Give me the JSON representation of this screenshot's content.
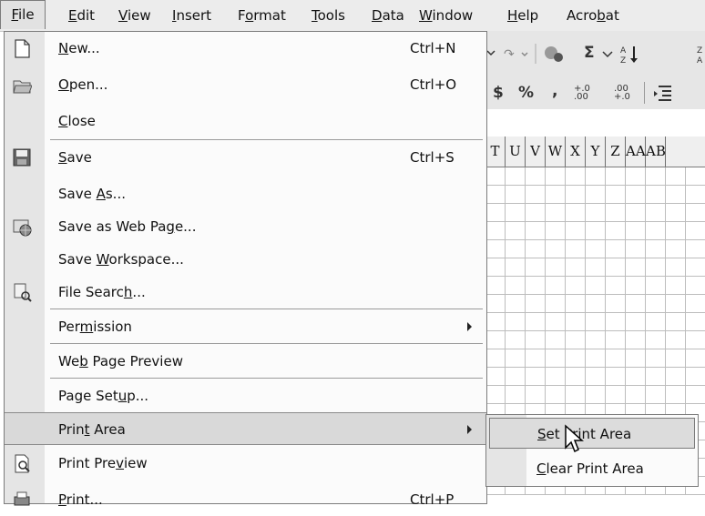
{
  "menubar": {
    "items": [
      {
        "label": "File",
        "key": "F",
        "rest": "ile"
      },
      {
        "label": "Edit",
        "key": "E",
        "rest": "dit"
      },
      {
        "label": "View",
        "key": "V",
        "rest": "iew"
      },
      {
        "label": "Insert",
        "key": "I",
        "rest": "nsert"
      },
      {
        "label": "Format",
        "pre": "F",
        "key": "o",
        "rest": "rmat"
      },
      {
        "label": "Tools",
        "key": "T",
        "rest": "ools"
      },
      {
        "label": "Data",
        "key": "D",
        "rest": "ata"
      },
      {
        "label": "Window",
        "key": "W",
        "rest": "indow"
      },
      {
        "label": "Help",
        "key": "H",
        "rest": "elp"
      },
      {
        "label": "Acrobat",
        "pre": "Acro",
        "key": "b",
        "rest": "at"
      }
    ]
  },
  "toolbar": {
    "sigma": "Σ",
    "dollar": "$",
    "percent": "%",
    "comma": ",",
    "inc_decimal": "+.0 .00",
    "dec_decimal": ".00 +.0"
  },
  "columns": [
    "T",
    "U",
    "V",
    "W",
    "X",
    "Y",
    "Z",
    "AA",
    "AB"
  ],
  "file_menu": {
    "items": [
      {
        "pre": "",
        "key": "N",
        "rest": "ew...",
        "shortcut": "Ctrl+N",
        "icon": "new-document-icon"
      },
      {
        "pre": "",
        "key": "O",
        "rest": "pen...",
        "shortcut": "Ctrl+O",
        "icon": "open-folder-icon"
      },
      {
        "pre": "",
        "key": "C",
        "rest": "lose",
        "shortcut": "",
        "icon": ""
      },
      {
        "pre": "",
        "key": "S",
        "rest": "ave",
        "shortcut": "Ctrl+S",
        "icon": "save-disk-icon"
      },
      {
        "pre": "Save ",
        "key": "A",
        "rest": "s...",
        "shortcut": "",
        "icon": ""
      },
      {
        "pre": "Save as Web Pa",
        "key": "g",
        "rest": "e...",
        "shortcut": "",
        "icon": "web-page-icon"
      },
      {
        "pre": "Save ",
        "key": "W",
        "rest": "orkspace...",
        "shortcut": "",
        "icon": ""
      },
      {
        "pre": "File Searc",
        "key": "h",
        "rest": "...",
        "shortcut": "",
        "icon": "file-search-icon"
      },
      {
        "pre": "Per",
        "key": "m",
        "rest": "ission",
        "shortcut": "",
        "icon": "",
        "submenu": true
      },
      {
        "pre": "We",
        "key": "b",
        "rest": " Page Preview",
        "shortcut": "",
        "icon": ""
      },
      {
        "pre": "Page Set",
        "key": "u",
        "rest": "p...",
        "shortcut": "",
        "icon": ""
      },
      {
        "pre": "Prin",
        "key": "t",
        "rest": " Area",
        "shortcut": "",
        "icon": "",
        "submenu": true,
        "highlighted": true
      },
      {
        "pre": "Print Pre",
        "key": "v",
        "rest": "iew",
        "shortcut": "",
        "icon": "print-preview-icon"
      },
      {
        "pre": "",
        "key": "P",
        "rest": "rint...",
        "shortcut": "Ctrl+P",
        "icon": "print-icon"
      }
    ]
  },
  "print_area_submenu": {
    "items": [
      {
        "pre": "",
        "key": "S",
        "rest": "et Print Area",
        "highlighted": true
      },
      {
        "pre": "",
        "key": "C",
        "rest": "lear Print Area",
        "highlighted": false
      }
    ]
  }
}
